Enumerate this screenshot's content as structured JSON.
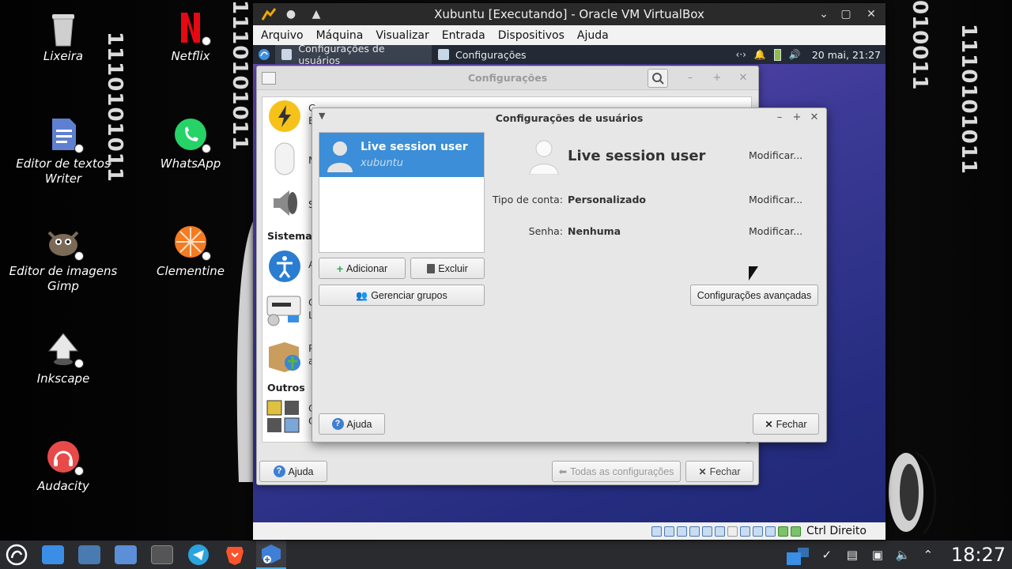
{
  "host": {
    "binary_left": "1110101011",
    "binary_left_top": "0011",
    "binary_right": "1110101011",
    "binary_right_top": "010011",
    "desktop_icons": [
      {
        "label": "Lixeira",
        "icon": "trash-icon"
      },
      {
        "label": "Netflix",
        "icon": "netflix-icon"
      },
      {
        "label": "Editor de textos Writer",
        "icon": "writer-icon"
      },
      {
        "label": "WhatsApp",
        "icon": "whatsapp-icon"
      },
      {
        "label": "Editor de imagens Gimp",
        "icon": "gimp-icon"
      },
      {
        "label": "Clementine",
        "icon": "clementine-icon"
      },
      {
        "label": "Inkscape",
        "icon": "inkscape-icon"
      },
      {
        "label": "Audacity",
        "icon": "audacity-icon"
      }
    ],
    "taskbar": {
      "apps": [
        "biglinux-menu-icon",
        "files-icon",
        "control-center-icon",
        "big-store-icon",
        "terminal-icon",
        "telegram-icon",
        "brave-icon",
        "virtualbox-icon"
      ],
      "clock": "18:27"
    }
  },
  "vbox": {
    "title": "Xubuntu [Executando] - Oracle VM VirtualBox",
    "menu": [
      "Arquivo",
      "Máquina",
      "Visualizar",
      "Entrada",
      "Dispositivos",
      "Ajuda"
    ],
    "host_key": "Ctrl Direito"
  },
  "guest": {
    "panel": {
      "tasks": [
        "Configurações de usuários",
        "Configurações"
      ],
      "clock": "20 mai, 21:27"
    },
    "settings": {
      "title": "Configurações",
      "categories": [
        "Sistema",
        "Outros"
      ],
      "footer": {
        "help": "Ajuda",
        "all_settings": "Todas as configurações",
        "close": "Fechar"
      },
      "partial_labels": {
        "row1a": "G",
        "row1b": "E",
        "row2": "M",
        "row3": "S",
        "row4": "A",
        "row5a": "C",
        "row5b": "Li",
        "row6a": "P",
        "row6b": "a",
        "row7a": "C",
        "row7b": "O"
      }
    },
    "users_dialog": {
      "title": "Configurações de usuários",
      "selected_user": {
        "name": "Live session user",
        "login": "xubuntu"
      },
      "detail": {
        "name": "Live session user",
        "account_type_label": "Tipo de conta:",
        "account_type_value": "Personalizado",
        "password_label": "Senha:",
        "password_value": "Nenhuma",
        "modify": "Modificar..."
      },
      "buttons": {
        "add": "Adicionar",
        "delete": "Excluir",
        "manage_groups": "Gerenciar grupos",
        "advanced": "Configurações avançadas",
        "help": "Ajuda",
        "close": "Fechar"
      }
    }
  }
}
